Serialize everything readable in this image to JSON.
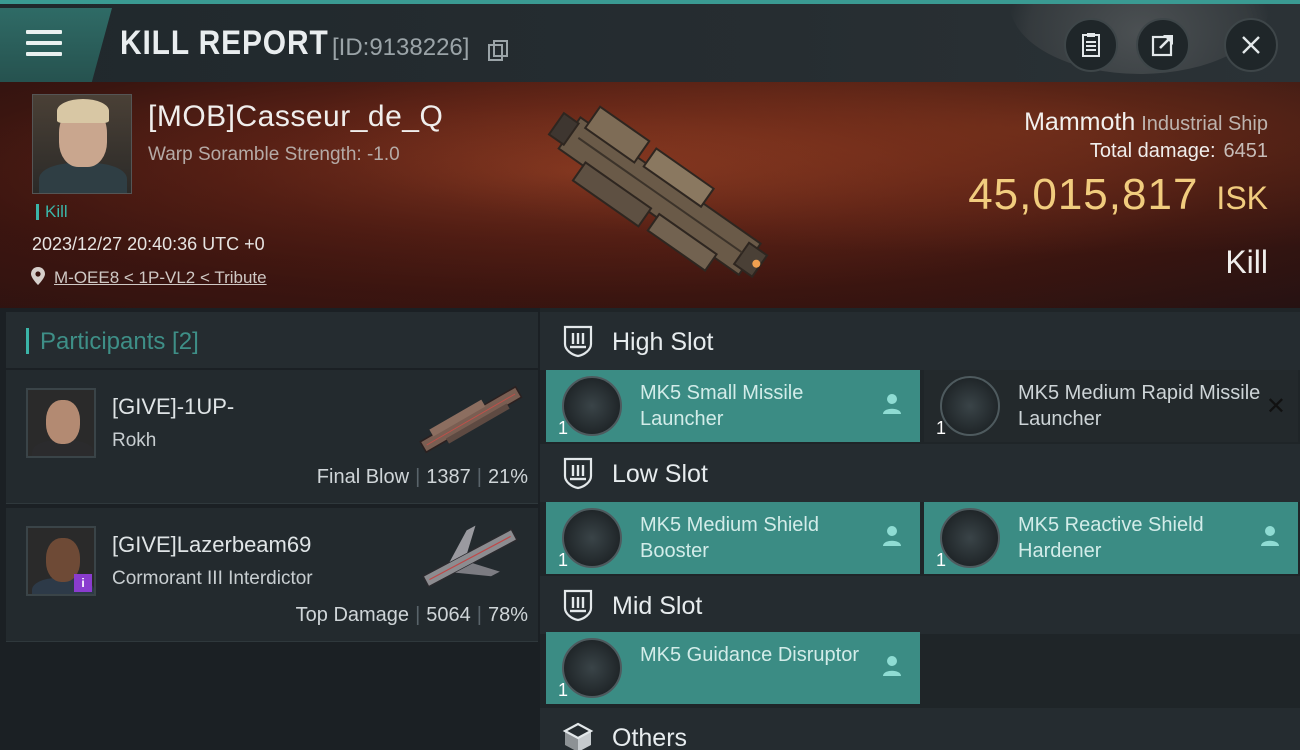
{
  "header": {
    "title": "KILL REPORT",
    "report_id": "[ID:9138226]"
  },
  "victim": {
    "pilot": "[MOB]Casseur_de_Q",
    "warp_scramble": "Warp Soramble Strength: -1.0",
    "tag": "Kill",
    "timestamp": "2023/12/27 20:40:36 UTC +0",
    "location": "M-OEE8 < 1P-VL2 < Tribute",
    "ship": "Mammoth",
    "ship_class": "Industrial Ship",
    "total_damage_label": "Total damage:",
    "total_damage": "6451",
    "isk_value": "45,015,817",
    "isk_unit": "ISK",
    "result": "Kill"
  },
  "participants": {
    "label": "Participants [2]",
    "rows": [
      {
        "name": "[GIVE]-1UP-",
        "ship": "Rokh",
        "role": "Final Blow",
        "damage": "1387",
        "percent": "21%"
      },
      {
        "name": "[GIVE]Lazerbeam69",
        "ship": "Cormorant III Interdictor",
        "role": "Top Damage",
        "damage": "5064",
        "percent": "78%"
      }
    ]
  },
  "slots": {
    "high": {
      "label": "High Slot",
      "items": [
        {
          "name": "MK5 Small Missile Launcher",
          "qty": "1"
        },
        {
          "name": "MK5 Medium Rapid Missile Launcher",
          "qty": "1"
        }
      ]
    },
    "low": {
      "label": "Low Slot",
      "items": [
        {
          "name": "MK5 Medium Shield Booster",
          "qty": "1"
        },
        {
          "name": "MK5 Reactive Shield Hardener",
          "qty": "1"
        }
      ]
    },
    "mid": {
      "label": "Mid Slot",
      "items": [
        {
          "name": "MK5 Guidance Disruptor",
          "qty": "1"
        }
      ]
    },
    "others": {
      "label": "Others"
    }
  },
  "colors": {
    "accent": "#3bb5a8",
    "fitted_item_bg": "#3b8c84",
    "isk_gold": "#f1cc7e"
  }
}
